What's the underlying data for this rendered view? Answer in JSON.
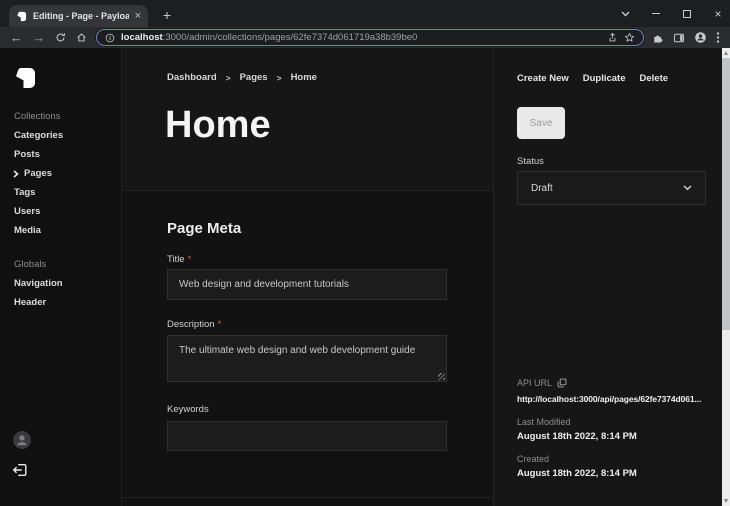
{
  "browser": {
    "tab_title": "Editing - Page - Payload",
    "url_host": "localhost",
    "url_rest": ":3000/admin/collections/pages/62fe7374d061719a38b39be0"
  },
  "sidebar": {
    "collections_label": "Collections",
    "collections": [
      {
        "label": "Categories"
      },
      {
        "label": "Posts"
      },
      {
        "label": "Pages"
      },
      {
        "label": "Tags"
      },
      {
        "label": "Users"
      },
      {
        "label": "Media"
      }
    ],
    "globals_label": "Globals",
    "globals": [
      {
        "label": "Navigation"
      },
      {
        "label": "Header"
      }
    ]
  },
  "breadcrumb": {
    "separator": ">",
    "items": [
      {
        "label": "Dashboard"
      },
      {
        "label": "Pages"
      },
      {
        "label": "Home"
      }
    ]
  },
  "main": {
    "title": "Home",
    "section_title": "Page Meta",
    "required_mark": "*",
    "fields": {
      "title": {
        "label": "Title",
        "value": "Web design and development tutorials"
      },
      "description": {
        "label": "Description",
        "value": "The ultimate web design and web development guide"
      },
      "keywords": {
        "label": "Keywords",
        "value": ""
      }
    }
  },
  "panel": {
    "actions": [
      {
        "label": "Create New"
      },
      {
        "label": "Duplicate"
      },
      {
        "label": "Delete"
      }
    ],
    "save_label": "Save",
    "status_label": "Status",
    "status_value": "Draft",
    "api_url_label": "API URL",
    "api_url": "http://localhost:3000/api/pages/62fe7374d061...",
    "last_modified_label": "Last Modified",
    "last_modified_value": "August 18th 2022, 8:14 PM",
    "created_label": "Created",
    "created_value": "August 18th 2022, 8:14 PM"
  },
  "colors": {
    "focus_ring": "#7583bb",
    "required": "#d9604a",
    "save_button_bg": "#e9e9e9",
    "panel_bg": "#161617",
    "input_bg": "#1c1c1d"
  }
}
